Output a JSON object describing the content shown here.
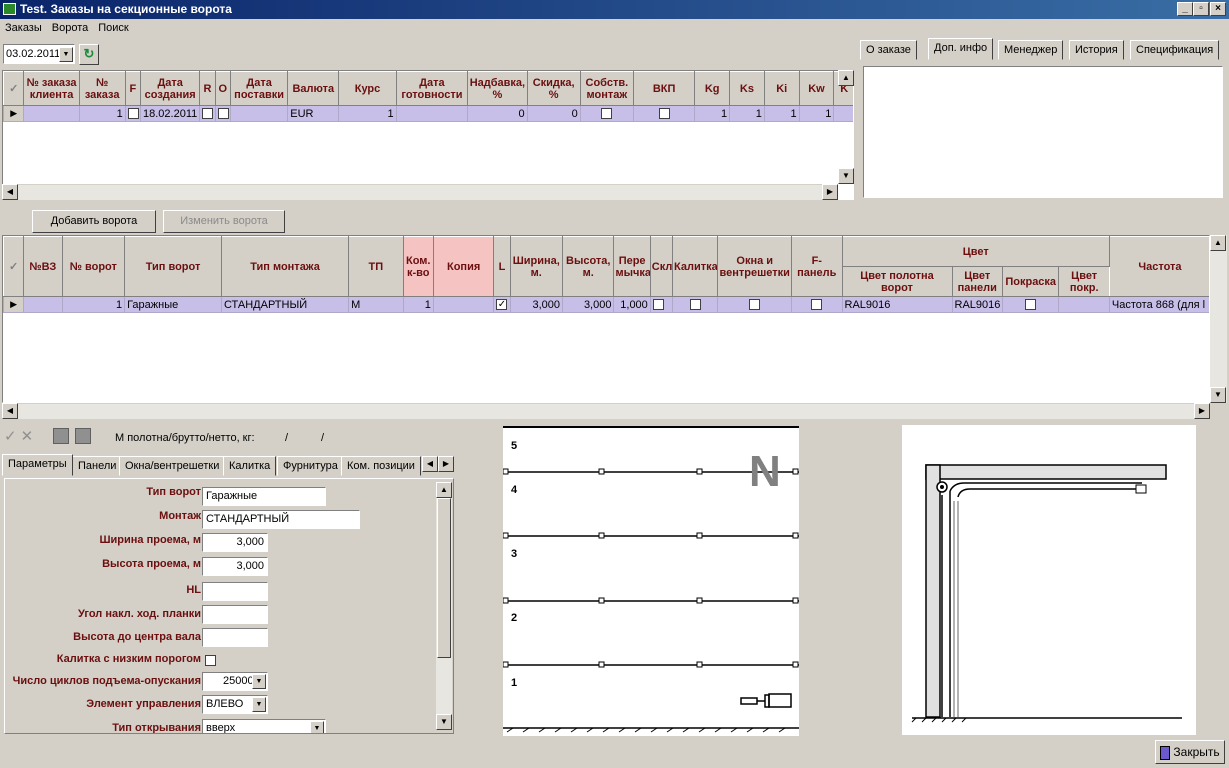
{
  "window": {
    "title": "Test. Заказы на секционные ворота",
    "minimize": "_",
    "restore": "▫",
    "close": "×"
  },
  "menu": [
    "Заказы",
    "Ворота",
    "Поиск"
  ],
  "toolbar": {
    "date_value": "03.02.2011"
  },
  "orders_table": {
    "headers": [
      "№ заказа клиента",
      "№ заказа",
      "F",
      "Дата создания",
      "R",
      "O",
      "Дата поставки",
      "Валюта",
      "Курс",
      "Дата готовности",
      "Надбавка, %",
      "Скидка, %",
      "Собств. монтаж",
      "ВКП",
      "Kg",
      "Ks",
      "Ki",
      "Kw",
      "K"
    ],
    "row": {
      "client_no": "",
      "order_no": "1",
      "created": "18.02.2011",
      "delivery": "",
      "currency": "EUR",
      "rate": "1",
      "ready": "",
      "markup": "0",
      "discount": "0",
      "kg": "1",
      "ks": "1",
      "ki": "1",
      "kw": "1"
    }
  },
  "info_tabs": [
    "О заказе",
    "Доп. инфо",
    "Менеджер",
    "История",
    "Спецификация"
  ],
  "gate_buttons": {
    "add": "Добавить ворота",
    "edit": "Изменить ворота"
  },
  "gates_table": {
    "headers": {
      "nvz": "№ВЗ",
      "gate_no": "№ ворот",
      "gate_type": "Тип ворот",
      "mount_type": "Тип монтажа",
      "tp": "ТП",
      "qty": "Ком. к-во",
      "copy": "Копия",
      "l": "L",
      "width": "Ширина, м.",
      "height": "Высота, м.",
      "lintel": "Пере мычка",
      "skl": "Скл",
      "wicket": "Калитка",
      "windows": "Окна и вентрешетки",
      "fpanel": "F-панель",
      "color": "Цвет",
      "color_sheet": "Цвет полотна ворот",
      "color_panel": "Цвет панели",
      "paint": "Покраска",
      "color_coat": "Цвет покр.",
      "freq": "Частота"
    },
    "row": {
      "nvz": "",
      "gate_no": "1",
      "gate_type": "Гаражные",
      "mount_type": "СТАНДАРТНЫЙ",
      "tp": "M",
      "qty": "1",
      "copy": "",
      "width": "3,000",
      "height": "3,000",
      "lintel": "1,000",
      "color_sheet": "RAL9016",
      "color_panel": "RAL9016",
      "color_coat": "",
      "freq": "Частота 868 (для l"
    }
  },
  "weight_label": "М полотна/брутто/нетто, кг:",
  "weight_separators": [
    "/",
    "/"
  ],
  "param_tabs": [
    "Параметры",
    "Панели",
    "Окна/вентрешетки",
    "Калитка",
    "Фурнитура",
    "Ком. позиции"
  ],
  "params": [
    {
      "label": "Тип ворот",
      "value": "Гаражные"
    },
    {
      "label": "Монтаж",
      "value": "СТАНДАРТНЫЙ"
    },
    {
      "label": "Ширина проема, м",
      "value": "3,000"
    },
    {
      "label": "Высота проема, м",
      "value": "3,000"
    },
    {
      "label": "HL",
      "value": ""
    },
    {
      "label": "Угол накл. ход. планки",
      "value": ""
    },
    {
      "label": "Высота до центра вала",
      "value": ""
    },
    {
      "label": "Калитка с низким порогом",
      "value": ""
    },
    {
      "label": "Число циклов подъема-опускания",
      "value": "25000"
    },
    {
      "label": "Элемент управления",
      "value": "ВЛЕВО"
    },
    {
      "label": "Тип открывания",
      "value": "вверх"
    }
  ],
  "door_preview": {
    "panels": [
      "5",
      "4",
      "3",
      "2",
      "1"
    ],
    "badge": "N"
  },
  "close_button": "Закрыть"
}
